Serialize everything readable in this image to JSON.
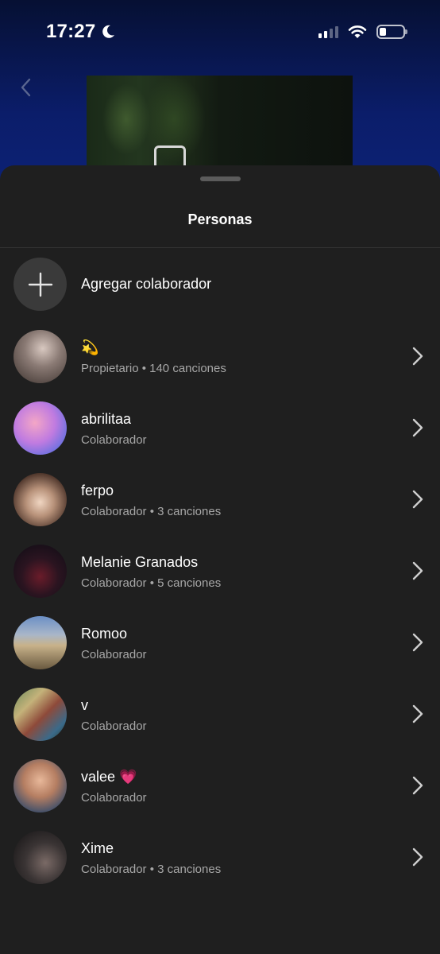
{
  "status_bar": {
    "time": "17:27"
  },
  "sheet": {
    "title": "Personas",
    "add_label": "Agregar colaborador"
  },
  "people": [
    {
      "name": "💫",
      "subtitle": "Propietario • 140 canciones"
    },
    {
      "name": "abrilitaa",
      "subtitle": "Colaborador"
    },
    {
      "name": "ferpo",
      "subtitle": "Colaborador • 3 canciones"
    },
    {
      "name": "Melanie Granados",
      "subtitle": "Colaborador • 5 canciones"
    },
    {
      "name": "Romoo",
      "subtitle": "Colaborador"
    },
    {
      "name": "v",
      "subtitle": "Colaborador"
    },
    {
      "name": "valee 💗",
      "subtitle": "Colaborador"
    },
    {
      "name": "Xime",
      "subtitle": "Colaborador • 3 canciones"
    }
  ],
  "colors": {
    "sheet_bg": "#1f1f1f",
    "subtitle": "#a7a7a7",
    "header_bg": "#0b1d6a"
  },
  "icons": [
    "moon-icon",
    "signal-icon",
    "wifi-icon",
    "battery-icon",
    "back-icon",
    "plus-icon",
    "chevron-right-icon"
  ]
}
